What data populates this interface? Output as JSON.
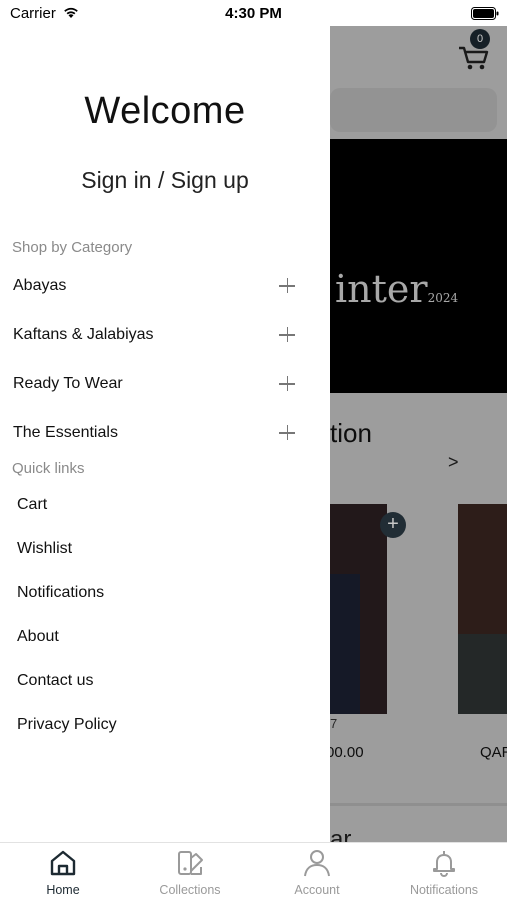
{
  "status_bar": {
    "carrier": "Carrier",
    "time": "4:30 PM"
  },
  "drawer": {
    "welcome": "Welcome",
    "signin": "Sign in / Sign up",
    "category_header": "Shop by Category",
    "categories": [
      {
        "label": "Abayas"
      },
      {
        "label": "Kaftans & Jalabiyas"
      },
      {
        "label": "Ready To Wear"
      },
      {
        "label": "The Essentials"
      }
    ],
    "quicklinks_header": "Quick links",
    "quicklinks": [
      {
        "label": "Cart"
      },
      {
        "label": "Wishlist"
      },
      {
        "label": "Notifications"
      },
      {
        "label": "About"
      },
      {
        "label": "Contact us"
      },
      {
        "label": "Privacy Policy"
      }
    ]
  },
  "background": {
    "cart_count": "0",
    "banner_text": "inter",
    "banner_year": "2024",
    "section_title": "tion",
    "section_arrow": ">",
    "product_1_name": "7",
    "product_1_price": "00.00",
    "product_2_price": "QAR",
    "next_section": "ar"
  },
  "tabs": [
    {
      "label": "Home",
      "icon": "home-icon",
      "active": true
    },
    {
      "label": "Collections",
      "icon": "collections-icon",
      "active": false
    },
    {
      "label": "Account",
      "icon": "account-icon",
      "active": false
    },
    {
      "label": "Notifications",
      "icon": "bell-icon",
      "active": false
    }
  ],
  "colors": {
    "accent": "#1d2a32",
    "inactive": "#9a9a9a",
    "overlay": "#c9c9c9"
  }
}
